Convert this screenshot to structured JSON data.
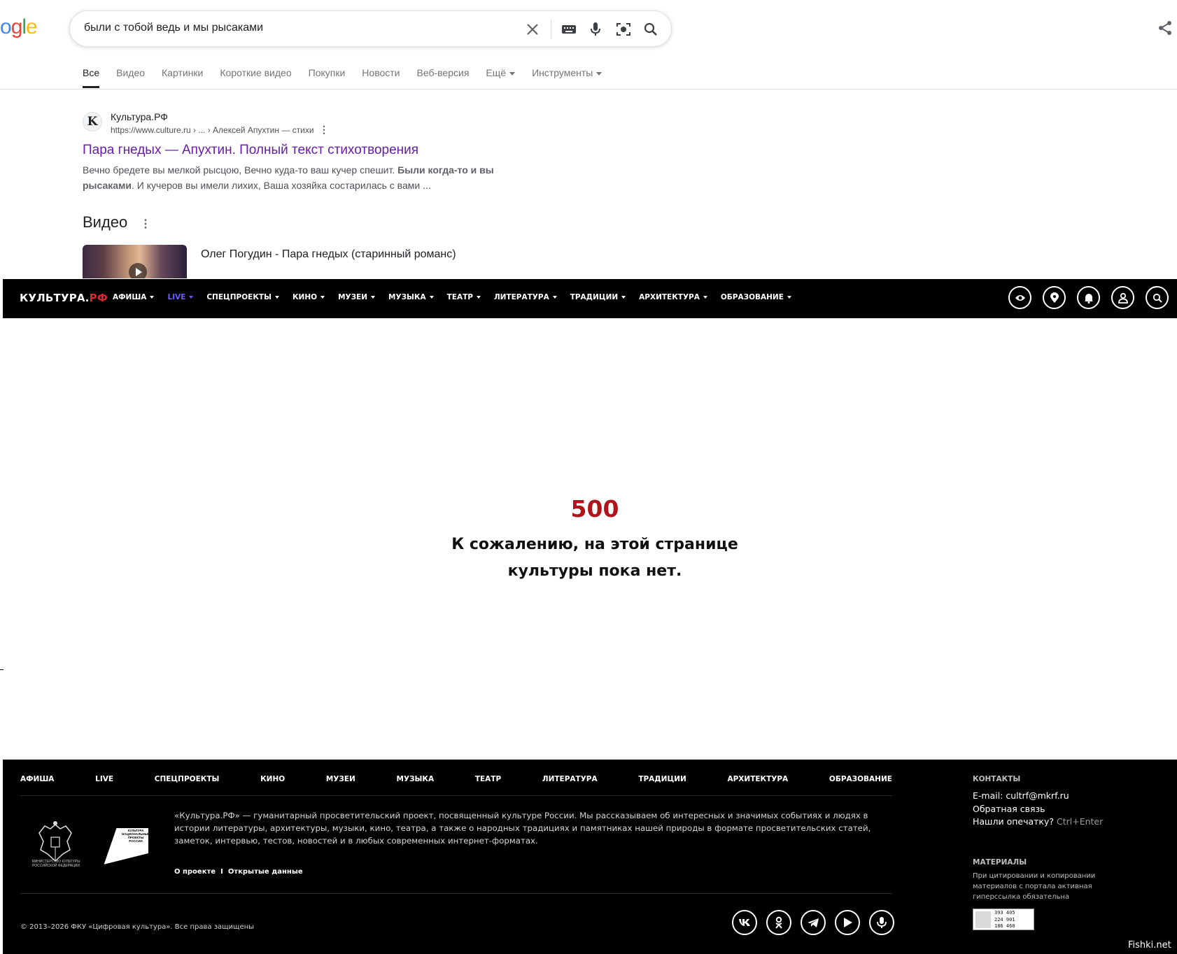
{
  "google": {
    "logo": {
      "b": "o",
      "r": "g",
      "gr": "l",
      "y": "e"
    },
    "search": {
      "query": "были с тобой ведь и мы рысаками"
    },
    "tabs": [
      {
        "label": "Все",
        "active": true
      },
      {
        "label": "Видео"
      },
      {
        "label": "Картинки"
      },
      {
        "label": "Короткие видео"
      },
      {
        "label": "Покупки"
      },
      {
        "label": "Новости"
      },
      {
        "label": "Веб-версия"
      },
      {
        "label": "Ещё"
      },
      {
        "label": "Инструменты"
      }
    ],
    "result": {
      "favicon_letter": "K",
      "site": "Культура.РФ",
      "url": "https://www.culture.ru › ... › Алексей Апухтин — стихи",
      "title": "Пара гнедых — Апухтин. Полный текст стихотворения",
      "snippet_1": "Вечно бредете вы мелкой рысцою, Вечно куда-то ваш кучер спешит. ",
      "snippet_bold_1": "Были когда-то и вы рысаками",
      "snippet_2": ". И кучеров вы имели лихих, Ваша хозяйка состарилась с вами ..."
    },
    "video_section": {
      "heading": "Видео",
      "first_title": "Олег Погудин - Пара гнедых (старинный романс)"
    }
  },
  "kultura": {
    "logo_main": "КУЛЬТУРА.",
    "logo_accent": "РФ",
    "nav": [
      {
        "label": "АФИША"
      },
      {
        "label": "LIVE",
        "accent": true
      },
      {
        "label": "СПЕЦПРОЕКТЫ"
      },
      {
        "label": "КИНО"
      },
      {
        "label": "МУЗЕИ"
      },
      {
        "label": "МУЗЫКА"
      },
      {
        "label": "ТЕАТР"
      },
      {
        "label": "ЛИТЕРАТУРА"
      },
      {
        "label": "ТРАДИЦИИ"
      },
      {
        "label": "АРХИТЕКТУРА"
      },
      {
        "label": "ОБРАЗОВАНИЕ"
      }
    ],
    "header_icons": [
      "eye-icon",
      "location-icon",
      "bell-icon",
      "user-icon",
      "search-icon"
    ],
    "error": {
      "code": "500",
      "line1": "К сожалению, на этой странице",
      "line2": "культуры пока нет."
    },
    "footer": {
      "nav": [
        "АФИША",
        "LIVE",
        "СПЕЦПРОЕКТЫ",
        "КИНО",
        "МУЗЕИ",
        "МУЗЫКА",
        "ТЕАТР",
        "ЛИТЕРАТУРА",
        "ТРАДИЦИИ",
        "АРХИТЕКТУРА",
        "ОБРАЗОВАНИЕ"
      ],
      "emblem_caption": "МИНИСТЕРСТВО КУЛЬТУРЫ РОССИЙСКОЙ ФЕДЕРАЦИИ",
      "np_caption": "КУЛЬТУРА НАЦИОНАЛЬНЫЕ ПРОЕКТЫ РОССИИ",
      "description": "«Культура.РФ» — гуманитарный просветительский проект, посвященный культуре России. Мы рассказываем об интересных и значимых событиях и людях в истории литературы, архитектуры, музыки, кино, театра, а также о народных традициях и памятниках нашей природы в формате просветительских статей, заметок, интервью, тестов, новостей и в любых современных интернет-форматах.",
      "link_about": "О проекте",
      "link_sep": "I",
      "link_open_data": "Открытые данные",
      "copyright": "© 2013–2026 ФКУ «Цифровая культура». Все права защищены",
      "social": [
        "vk-icon",
        "ok-icon",
        "telegram-icon",
        "youtube-icon",
        "podcast-icon"
      ],
      "contacts_heading": "КОНТАКТЫ",
      "email": "E-mail: cultrf@mkrf.ru",
      "feedback": "Обратная связь",
      "typo_question": "Нашли опечатку?",
      "typo_shortcut": "Ctrl+Enter",
      "materials_heading": "МАТЕРИАЛЫ",
      "materials_text": "При цитировании и копировании материалов с портала активная гиперссылка обязательна",
      "counter": [
        "393 405",
        "224 901",
        "186 460"
      ]
    }
  },
  "watermark": "Fishki.net",
  "colors": {
    "accent_red": "#e0252b",
    "error_red": "#b1151b",
    "live_purple": "#6b5bff",
    "visited_link": "#681da8"
  }
}
